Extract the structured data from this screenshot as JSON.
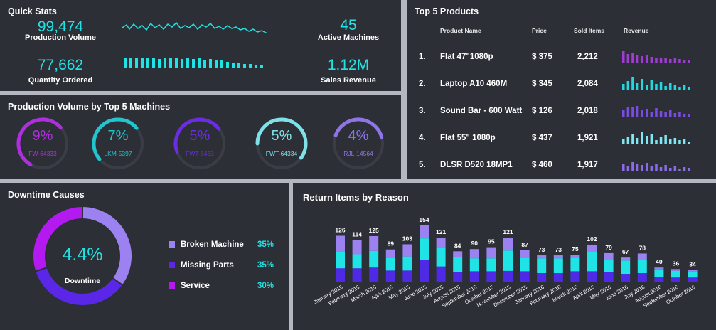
{
  "quick_stats": {
    "title": "Quick Stats",
    "production_volume": {
      "value": "99,474",
      "label": "Production Volume"
    },
    "quantity_ordered": {
      "value": "77,662",
      "label": "Quantity Ordered"
    },
    "active_machines": {
      "value": "45",
      "label": "Active Machines"
    },
    "sales_revenue": {
      "value": "1.12M",
      "label": "Sales Revenue"
    }
  },
  "top_products": {
    "title": "Top 5 Products",
    "headers": {
      "name": "Product Name",
      "price": "Price",
      "sold": "Sold Items",
      "revenue": "Revenue"
    },
    "rows": [
      {
        "rank": "1.",
        "name": "Flat 47\"1080p",
        "price": "$ 375",
        "sold": "2,212",
        "color": "#a23bd6"
      },
      {
        "rank": "2.",
        "name": "Laptop A10 460M",
        "price": "$ 345",
        "sold": "2,084",
        "color": "#22d8e0"
      },
      {
        "rank": "3.",
        "name": "Sound Bar - 600 Watt",
        "price": "$ 126",
        "sold": "2,018",
        "color": "#7b4be6"
      },
      {
        "rank": "4.",
        "name": "Flat 55\" 1080p",
        "price": "$ 437",
        "sold": "1,921",
        "color": "#7fe7ef"
      },
      {
        "rank": "5.",
        "name": "DLSR D520 18MP1",
        "price": "$ 460",
        "sold": "1,917",
        "color": "#8a6ce8"
      }
    ]
  },
  "machines": {
    "title": "Production Volume by Top 5 Machines",
    "items": [
      {
        "pct": "9%",
        "id": "FW-64333",
        "fill": 0.55,
        "color": "#b02ee0"
      },
      {
        "pct": "7%",
        "id": "LKM-5397",
        "fill": 0.5,
        "color": "#21c4cf"
      },
      {
        "pct": "5%",
        "id": "FWT-6433",
        "fill": 0.45,
        "color": "#6a2de0"
      },
      {
        "pct": "5%",
        "id": "FWT-64334",
        "fill": 0.6,
        "color": "#7fe0e8"
      },
      {
        "pct": "4%",
        "id": "RJL-14564",
        "fill": 0.4,
        "color": "#8e74e6"
      }
    ]
  },
  "downtime": {
    "title": "Downtime Causes",
    "center_value": "4.4%",
    "center_label": "Downtime",
    "legend": [
      {
        "label": "Broken Machine",
        "pct": "35%",
        "value": 35,
        "color": "#9b82f0"
      },
      {
        "label": "Missing Parts",
        "pct": "35%",
        "value": 35,
        "color": "#5a27e8"
      },
      {
        "label": "Service",
        "pct": "30%",
        "value": 30,
        "color": "#b21af0"
      }
    ]
  },
  "returns": {
    "title": "Return Items by Reason"
  },
  "chart_data": {
    "type": "bar",
    "title": "Return Items by Reason",
    "categories": [
      "January 2015",
      "February 2015",
      "March 2015",
      "April 2015",
      "May 2015",
      "June 2015",
      "July 2015",
      "August 2015",
      "September 2015",
      "October 2015",
      "November 2015",
      "December 2015",
      "January 2016",
      "February 2016",
      "March 2016",
      "April 2016",
      "May 2016",
      "June 2016",
      "July 2016",
      "August 2016",
      "September 2016",
      "October 2016"
    ],
    "totals": [
      126,
      114,
      125,
      89,
      103,
      154,
      121,
      84,
      90,
      95,
      121,
      87,
      73,
      73,
      75,
      102,
      79,
      67,
      78,
      40,
      36,
      34
    ],
    "series": [
      {
        "values": [
          45,
          38,
          40,
          22,
          33,
          35,
          28,
          16,
          25,
          30,
          35,
          20,
          8,
          8,
          8,
          18,
          18,
          8,
          18,
          5,
          5,
          5
        ],
        "color": "#9b82f0"
      },
      {
        "values": [
          43,
          38,
          45,
          35,
          38,
          59,
          50,
          40,
          35,
          35,
          55,
          37,
          40,
          40,
          37,
          54,
          33,
          36,
          35,
          20,
          18,
          16
        ],
        "color": "#20e3e6"
      },
      {
        "values": [
          38,
          38,
          40,
          32,
          32,
          60,
          43,
          28,
          30,
          30,
          31,
          30,
          25,
          25,
          30,
          30,
          28,
          23,
          25,
          15,
          13,
          13
        ],
        "color": "#4f2ae6"
      }
    ]
  }
}
